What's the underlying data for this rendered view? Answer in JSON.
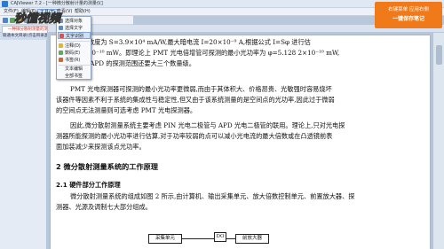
{
  "window": {
    "title": "CAJViewer 7.2 - [一种微分散射计量的测量仪]"
  },
  "menu": {
    "items": [
      "文件(F)",
      "编辑(E)",
      "工具(T)",
      "查看(V)",
      "帮助(H)"
    ]
  },
  "tab": {
    "label": "一种微分散射测量的测量仪"
  },
  "sidebar": {
    "header": "联通本文目录(点击目录查看)"
  },
  "dropdown": {
    "items": [
      "选择对象",
      "选择文字",
      "文字识别",
      "",
      "注释(D)",
      "数码(E)",
      "书签(R)",
      "",
      "文本编辑",
      "",
      "全部书签",
      "类别"
    ]
  },
  "banner": {
    "line1": "右键菜单 应用右侧",
    "line2": "一键保存笔记"
  },
  "logo": {
    "text": "秒懂视频"
  },
  "document": {
    "lines": [
      "阴极电流灵敏度为 S=3.9×10⁴ mA/W,最大暗电流 I=20×10⁻⁹ A,根据公式 I=Sφ 进行估",
      "计 I=3.2×10⁻¹⁰ mW。即理论上 PMT 光电倍增管可探测的最小光功率为 φ=5.128 2×10⁻¹⁰ mW,",
      "而采用了比 APD 的探测范围还要大三个数量级。",
      "PMT 光电探测器可探测的最小光功率更微弱,而由于其体积大、价格昂贵、光敏强时容易烧坏",
      "该器件等因素不利于系统的集成性与稳定性,但又由于该系统测量的是空间点的光功率,因此过于微弱",
      "的空间点无法测量则可选考虑 PMT 光电探测器。",
      "因此,微分散射测量系统主要考虑 PIN 光电二极管与 APD 光电二极管的联用。理论上,只对光电探",
      "测器所能探测的最小光功率进行估算,对于功率较弱的点可以减小光电流的最大倍数或在凸透镜前表",
      "面加装减少来探测该点光功率。"
    ],
    "section2": "2  微分散射测量系统的工作原理",
    "section21": "2.1  硬件部分工作原理",
    "para2": [
      "微分散射测量系统的组成如图 2 所示,由计算机、输出采集单元、放大倍数控制单元、前置放大器、探",
      "测器、光源及调制七大部分组成。"
    ],
    "diagram": {
      "box1": "采集单元",
      "box2": "DO",
      "box3": "前放大器"
    }
  }
}
